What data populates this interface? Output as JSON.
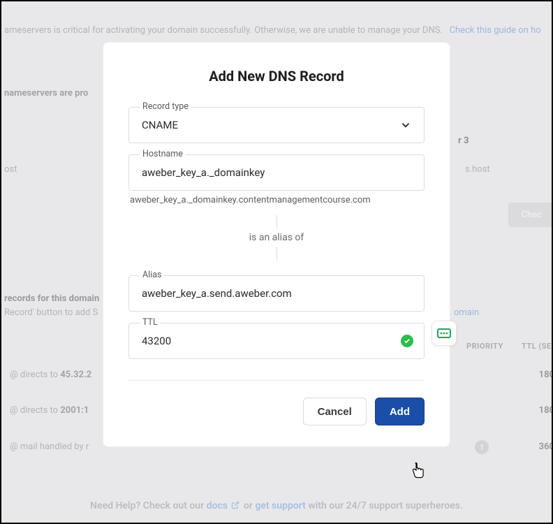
{
  "background": {
    "banner_text": "ameservers is critical for activating your domain successfully. Otherwise, we are unable to manage your DNS.",
    "banner_link": "Check this guide on ho",
    "nameservers_heading": "nameservers are pro",
    "host_label": "ost",
    "ns3": "r 3",
    "ns3_host": "s.host",
    "check_btn": "Chec",
    "records_text": "records for this domain",
    "records_sub": "Record' button to add S",
    "records_link": "omain",
    "th_priority": "PRIORITY",
    "th_ttl": "TTL (SE",
    "row1_pre": "@ directs to",
    "row1_bold": "45.32.2",
    "row1_ttl": "180",
    "row2_pre": "@ directs to",
    "row2_bold": "2001:1",
    "row2_ttl": "180",
    "row3_text": "@ mail handled by r",
    "row3_badge": "1",
    "row3_ttl": "360",
    "help_pre": "Need Help? Check out our",
    "help_docs": "docs",
    "help_mid": "or",
    "help_support": "get support",
    "help_post": "with our 24/7 support superheroes."
  },
  "modal": {
    "title": "Add New DNS Record",
    "record_type_label": "Record type",
    "record_type_value": "CNAME",
    "hostname_label": "Hostname",
    "hostname_value": "aweber_key_a._domainkey",
    "full_hostname": "aweber_key_a._domainkey.contentmanagementcourse.com",
    "alias_of": "is an alias of",
    "alias_label": "Alias",
    "alias_value": "aweber_key_a.send.aweber.com",
    "ttl_label": "TTL",
    "ttl_value": "43200",
    "cancel": "Cancel",
    "add": "Add"
  }
}
